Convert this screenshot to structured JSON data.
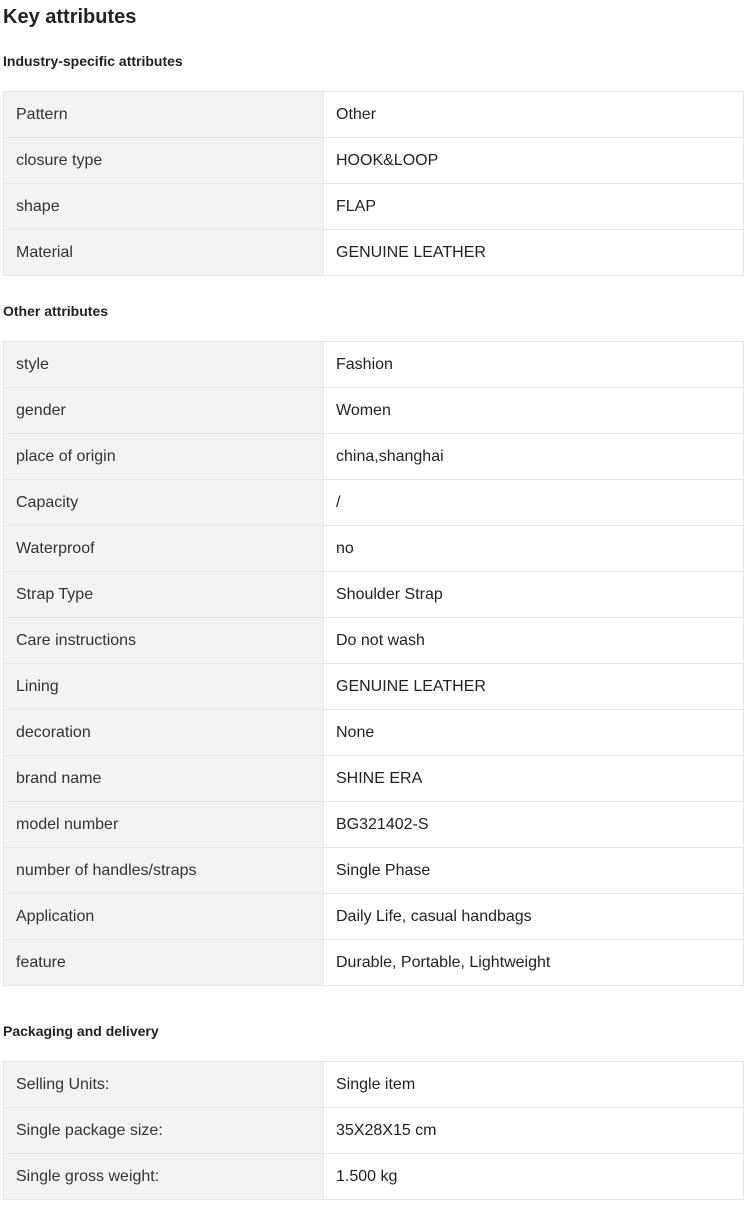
{
  "heading": "Key attributes",
  "sections": [
    {
      "title": "Industry-specific attributes",
      "rows": [
        {
          "key": "Pattern",
          "value": "Other"
        },
        {
          "key": "closure type",
          "value": "HOOK&LOOP"
        },
        {
          "key": "shape",
          "value": "FLAP"
        },
        {
          "key": "Material",
          "value": "GENUINE LEATHER"
        }
      ]
    },
    {
      "title": "Other attributes",
      "rows": [
        {
          "key": "style",
          "value": "Fashion"
        },
        {
          "key": "gender",
          "value": "Women"
        },
        {
          "key": "place of origin",
          "value": "china,shanghai"
        },
        {
          "key": "Capacity",
          "value": "/"
        },
        {
          "key": "Waterproof",
          "value": "no"
        },
        {
          "key": "Strap Type",
          "value": "Shoulder Strap"
        },
        {
          "key": "Care instructions",
          "value": "Do not wash"
        },
        {
          "key": "Lining",
          "value": "GENUINE LEATHER"
        },
        {
          "key": "decoration",
          "value": "None"
        },
        {
          "key": "brand name",
          "value": "SHINE ERA"
        },
        {
          "key": "model number",
          "value": "BG321402-S"
        },
        {
          "key": "number of handles/straps",
          "value": "Single Phase"
        },
        {
          "key": "Application",
          "value": "Daily Life, casual handbags"
        },
        {
          "key": "feature",
          "value": "Durable, Portable, Lightweight"
        }
      ]
    },
    {
      "title": "Packaging and delivery",
      "rows": [
        {
          "key": "Selling Units:",
          "value": "Single item"
        },
        {
          "key": "Single package size:",
          "value": "35X28X15 cm"
        },
        {
          "key": "Single gross weight:",
          "value": "1.500 kg"
        }
      ]
    }
  ]
}
